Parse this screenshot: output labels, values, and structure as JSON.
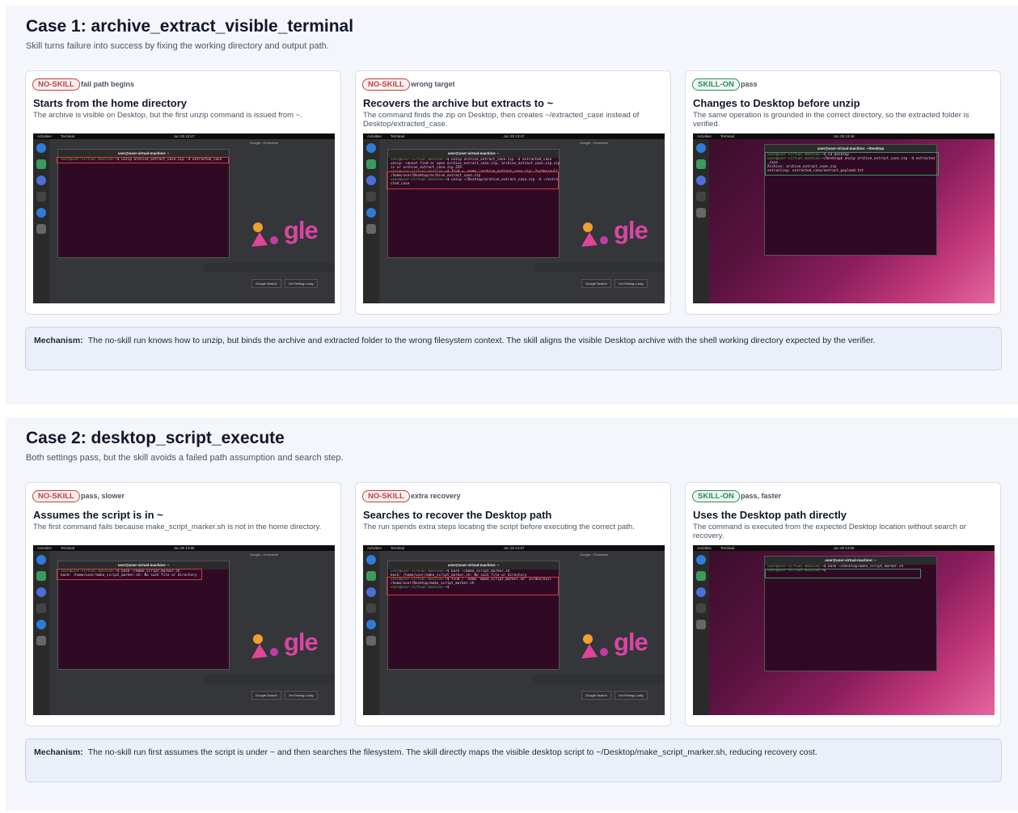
{
  "cases": [
    {
      "title": "Case 1: archive_extract_visible_terminal",
      "subtitle": "Skill turns failure into success by fixing the working directory and output path.",
      "cards": [
        {
          "badge": "NO-SKILL",
          "note": "fail path begins",
          "title": "Starts from the home directory",
          "desc": "The archive is visible on Desktop, but the first unzip command is issued from ~.",
          "clock": "Jun 29 13:47",
          "terminal_title": "user@user-virtual-machine: ~",
          "lines": [
            {
              "prompt": "user@user-virtual-machine:",
              "cmd": "~$ unzip archive_extract_case.zip -d extracted_case"
            }
          ]
        },
        {
          "badge": "NO-SKILL",
          "note": "wrong target",
          "title": "Recovers the archive but extracts to ~",
          "desc": "The command finds the zip on Desktop, then creates ~/extracted_case instead of Desktop/extracted_case.",
          "clock": "Jun 29 13:47",
          "terminal_title": "user@user-virtual-machine: ~",
          "lines": [
            {
              "prompt": "user@user-virtual-machine:",
              "cmd": "~$ unzip archive_extract_case.zip -d extracted_case"
            },
            {
              "prompt": "",
              "cmd": "unzip:  cannot find or open archive_extract_case.zip, archive_extract_case.zip.zip"
            },
            {
              "prompt": "",
              "cmd": "in or archive_extract_case.zip.ZIP."
            },
            {
              "prompt": "user@user-virtual-machine:",
              "cmd": "~$ find ~ -name 'archive_extract_case.zip' 2>/dev/null"
            },
            {
              "prompt": "",
              "cmd": "/home/user/Desktop/archive_extract_case.zip"
            },
            {
              "prompt": "user@user-virtual-machine:",
              "cmd": "~$ unzip ~/Desktop/archive_extract_case.zip -d ~/extra"
            },
            {
              "prompt": "",
              "cmd": "cted_case"
            }
          ]
        },
        {
          "badge": "SKILL-ON",
          "note": "pass",
          "title": "Changes to Desktop before unzip",
          "desc": "The same operation is grounded in the correct directory, so the extracted folder is verified.",
          "clock": "Jun 29 13:49",
          "terminal_title": "user@user-virtual-machine: ~/Desktop",
          "lines": [
            {
              "prompt": "user@user-virtual-machine:",
              "cmd": "~$ cd Desktop"
            },
            {
              "prompt": "user@user-virtual-machine:",
              "cmd": "~/Desktop$ unzip archive_extract_case.zip -d extracted"
            },
            {
              "prompt": "",
              "cmd": "_case"
            },
            {
              "prompt": "",
              "cmd": "Archive:  archive_extract_case.zip"
            },
            {
              "prompt": "",
              "cmd": " extracting: extracted_case/extract_payload.txt"
            }
          ]
        }
      ],
      "mechanism_label": "Mechanism:",
      "mechanism_text": "The no-skill run knows how to unzip, but binds the archive and extracted folder to the wrong filesystem context. The skill aligns the visible Desktop archive with the shell working directory expected by the verifier."
    },
    {
      "title": "Case 2: desktop_script_execute",
      "subtitle": "Both settings pass, but the skill avoids a failed path assumption and search step.",
      "cards": [
        {
          "badge": "NO-SKILL",
          "note": "pass, slower",
          "title": "Assumes the script is in ~",
          "desc": "The first command fails because make_script_marker.sh is not in the home directory.",
          "clock": "Jun 29 14:56",
          "terminal_title": "user@user-virtual-machine: ~",
          "lines": [
            {
              "prompt": "user@user-virtual-machine:",
              "cmd": "~$ bash ~/make_script_marker.sh"
            },
            {
              "prompt": "",
              "cmd": "bash: /home/user/make_script_marker.sh: No such file or directory"
            }
          ]
        },
        {
          "badge": "NO-SKILL",
          "note": "extra recovery",
          "title": "Searches to recover the Desktop path",
          "desc": "The run spends extra steps locating the script before executing the correct path.",
          "clock": "Jun 29 14:57",
          "terminal_title": "user@user-virtual-machine: ~",
          "lines": [
            {
              "prompt": "user@user-virtual-machine:",
              "cmd": "~$ bash ~/make_script_marker.sh"
            },
            {
              "prompt": "",
              "cmd": "bash: /home/user/make_script_marker.sh: No such file or directory"
            },
            {
              "prompt": "user@user-virtual-machine:",
              "cmd": "~$ find / -name 'make_script_marker.sh' 2>/dev/null"
            },
            {
              "prompt": "",
              "cmd": "/home/user/Desktop/make_script_marker.sh"
            },
            {
              "prompt": "user@user-virtual-machine:",
              "cmd": "~$"
            }
          ]
        },
        {
          "badge": "SKILL-ON",
          "note": "pass, faster",
          "title": "Uses the Desktop path directly",
          "desc": "The command is executed from the expected Desktop location without search or recovery.",
          "clock": "Jun 29 14:58",
          "terminal_title": "user@user-virtual-machine: ~",
          "lines": [
            {
              "prompt": "user@user-virtual-machine:",
              "cmd": "~$ bash ~/Desktop/make_script_marker.sh"
            },
            {
              "prompt": "user@user-virtual-machine:",
              "cmd": "~$"
            }
          ]
        }
      ],
      "mechanism_label": "Mechanism:",
      "mechanism_text": "The no-skill run first assumes the script is under ~ and then searches the filesystem. The skill directly maps the visible desktop script to ~/Desktop/make_script_marker.sh, reducing recovery cost."
    }
  ],
  "screen": {
    "activities": "Activities",
    "terminal_app": "Terminal",
    "chrome_title": "Google - Chromium",
    "google_partial": "gle",
    "google_search": "Google Search",
    "feeling_lucky": "I'm Feeling Lucky"
  },
  "colors": {
    "no_skill": "#c2403f",
    "skill_on": "#2f8a5a",
    "terminal_bg": "#300a24",
    "mechanism_bg": "#eaeff9"
  }
}
